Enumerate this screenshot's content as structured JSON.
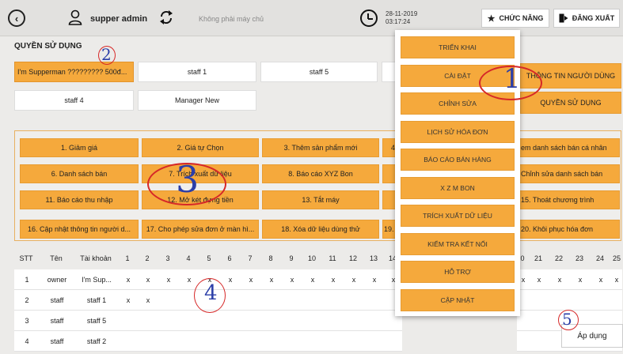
{
  "header": {
    "username": "supper admin",
    "server_status": "Không phải máy chủ",
    "date": "28-11-2019",
    "time": "03:17:24",
    "function_button": "CHỨC NĂNG",
    "logout_button": "ĐĂNG XUẤT"
  },
  "section_title": "QUYỀN SỬ DỤNG",
  "staff_buttons": [
    "I'm Supperman ????????? 500đ...",
    "staff 1",
    "staff 5",
    "",
    "staff 4",
    "Manager New"
  ],
  "permissions": [
    "1. Giảm giá",
    "2. Giá tự Chọn",
    "3. Thêm sản phẩm mới",
    "4",
    "em danh sách bán cá nhân",
    "6. Danh sách bán",
    "7. Trích xuất dữ liệu",
    "8. Báo cáo XYZ Bon",
    "",
    "Chỉnh sửa danh sách bán",
    "11. Báo cáo thu nhập",
    "12. Mở két đựng tiền",
    "13. Tắt máy",
    "",
    "15. Thoát chương trình",
    "16. Cập nhật thông tin người d...",
    "17. Cho phép sửa đơn ở màn hì...",
    "18. Xóa dữ liệu dùng thử",
    "19. ",
    "20. Khôi phục hóa đơn"
  ],
  "table": {
    "headers": [
      "STT",
      "Tên",
      "Tài khoản",
      "1",
      "2",
      "3",
      "4",
      "5",
      "6",
      "7",
      "8",
      "9",
      "10",
      "11",
      "12",
      "13",
      "14",
      "0",
      "21",
      "22",
      "23",
      "24",
      "25"
    ],
    "rows": [
      [
        "1",
        "owner",
        "I'm Sup...",
        "x",
        "x",
        "x",
        "x",
        "x",
        "x",
        "x",
        "x",
        "x",
        "x",
        "x",
        "x",
        "x",
        "x",
        "x",
        "x",
        "x",
        "x",
        "x",
        "x"
      ],
      [
        "2",
        "staff",
        "staff 1",
        "x",
        "x",
        "",
        "",
        "",
        "",
        "",
        "",
        "",
        "",
        "",
        "",
        "",
        "",
        "",
        "",
        "",
        "",
        "",
        ""
      ],
      [
        "3",
        "staff",
        "staff 5",
        "",
        "",
        "",
        "",
        "",
        "",
        "",
        "",
        "",
        "",
        "",
        "",
        "",
        "",
        "",
        "",
        "",
        "",
        "",
        ""
      ],
      [
        "4",
        "staff",
        "staff 2",
        "",
        "",
        "",
        "",
        "",
        "",
        "",
        "",
        "",
        "",
        "",
        "",
        "",
        "",
        "",
        "",
        "",
        "",
        "",
        ""
      ]
    ]
  },
  "menu": [
    "TRIỂN KHAI",
    "CÀI ĐẶT",
    "CHỈNH SỬA",
    "LỊCH SỬ HÓA ĐƠN",
    "BÁO CÁO BÁN HÀNG",
    "X Z M BON",
    "TRÍCH XUẤT DỮ LIỆU",
    "KIỂM TRA KẾT NỐI",
    "HỖ TRỢ",
    "CẬP NHẬT"
  ],
  "side_buttons": [
    "THÔNG TIN NGƯỜI DÙNG",
    "QUYỀN SỬ DỤNG"
  ],
  "apply_button": "Áp dụng",
  "annotations": [
    "1",
    "2",
    "3",
    "4",
    "5"
  ],
  "colors": {
    "accent": "#f5a93c",
    "annotation_number": "#2b3ea8",
    "annotation_ellipse": "#d62828"
  }
}
